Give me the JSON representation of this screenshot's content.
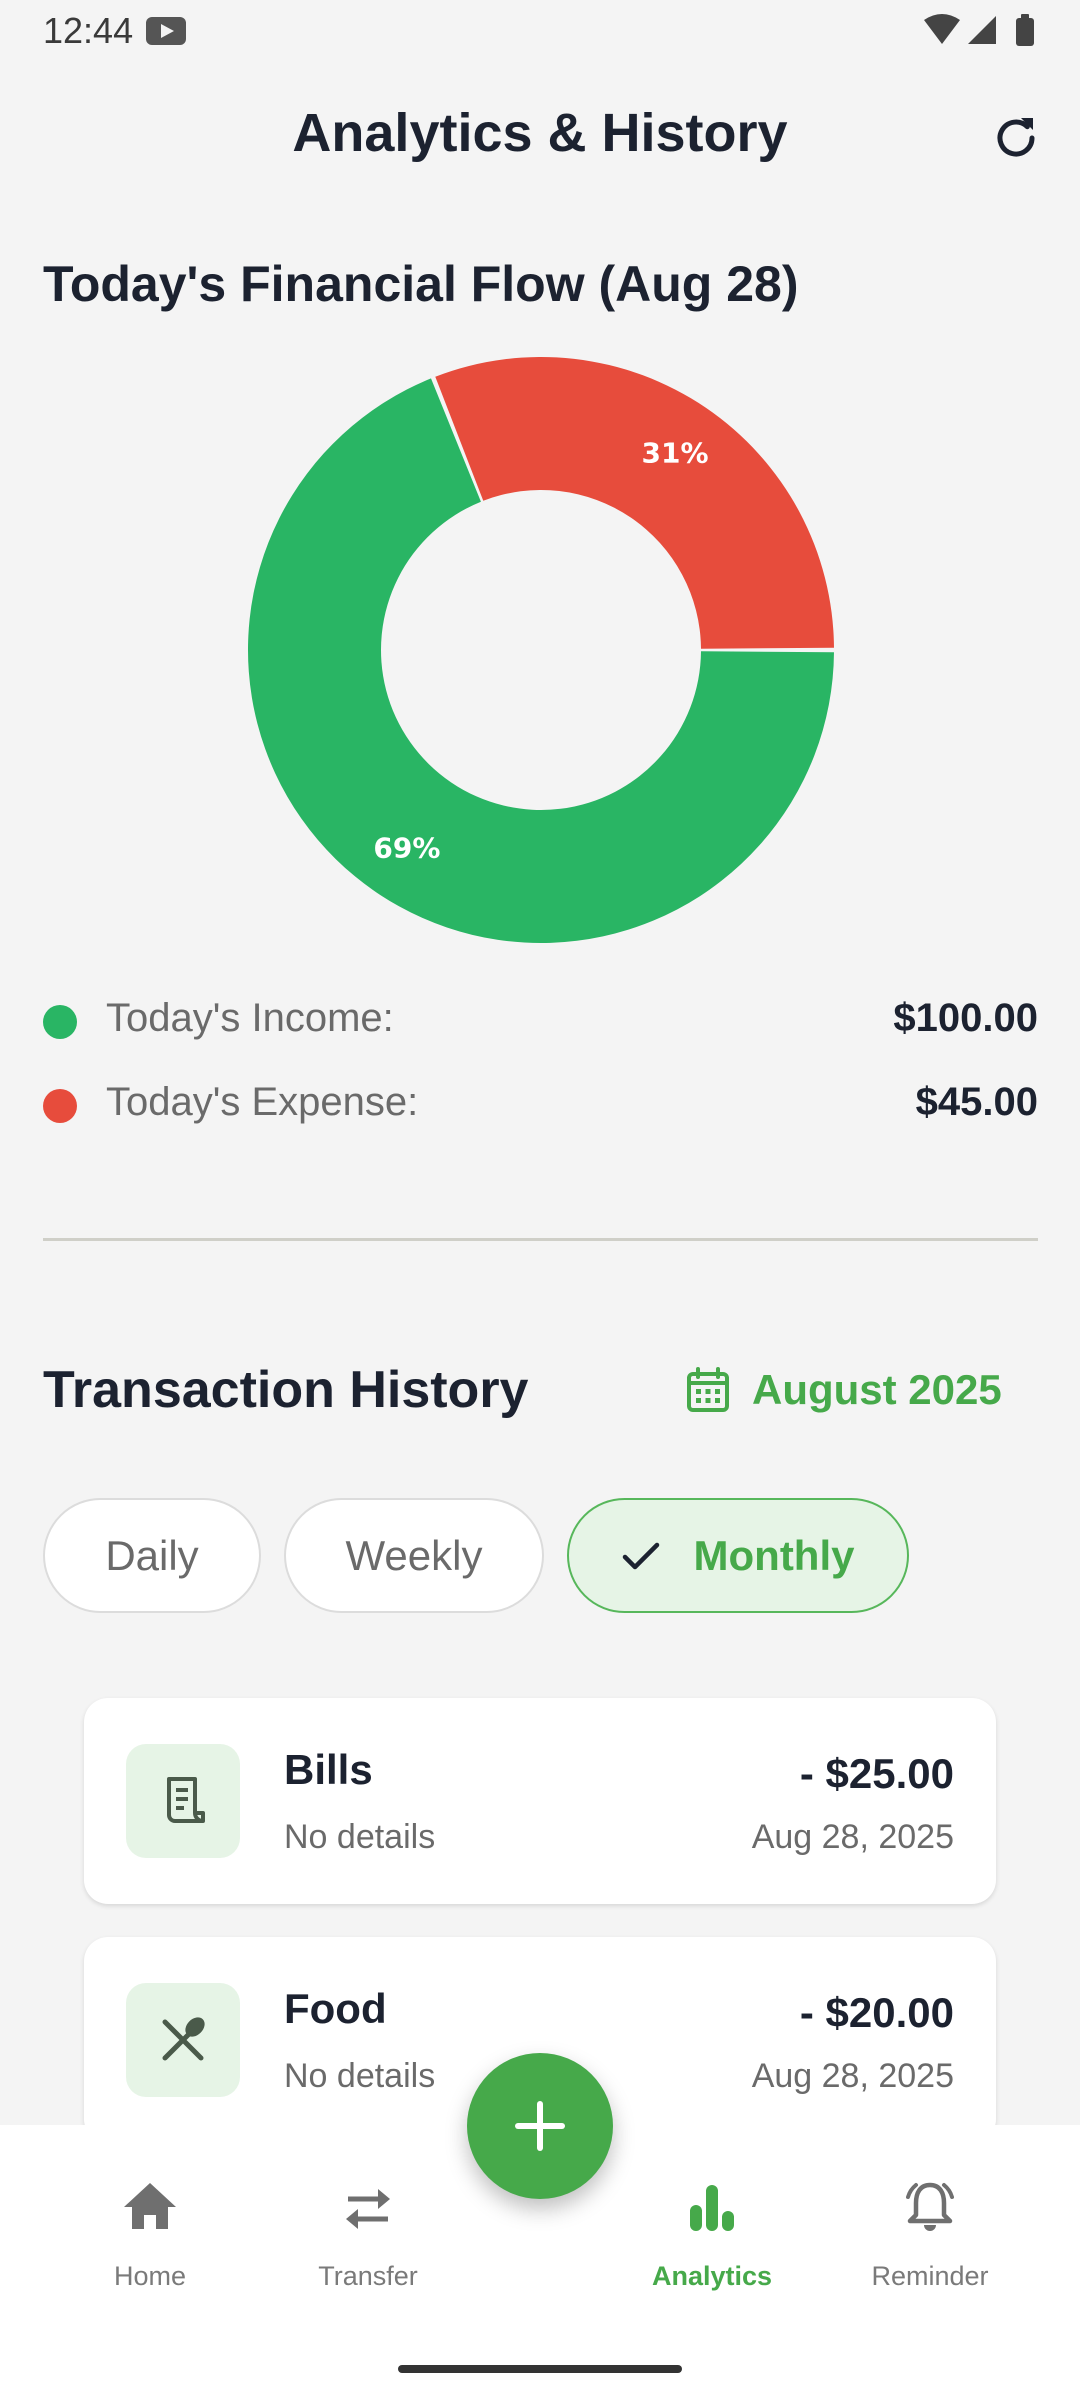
{
  "status_bar": {
    "time": "12:44"
  },
  "header": {
    "title": "Analytics & History"
  },
  "financial_flow": {
    "title": "Today's Financial Flow (Aug 28)",
    "chart_data": {
      "type": "pie",
      "categories": [
        "Today's Income",
        "Today's Expense"
      ],
      "values": [
        69,
        31
      ],
      "data_labels": [
        "69%",
        "31%"
      ],
      "colors": [
        "#29b564",
        "#e74c3c"
      ]
    },
    "legend": [
      {
        "label": "Today's Income:",
        "value": "$100.00",
        "color": "#29b564"
      },
      {
        "label": "Today's Expense:",
        "value": "$45.00",
        "color": "#e74c3c"
      }
    ]
  },
  "history": {
    "title": "Transaction History",
    "month": "August 2025",
    "filters": [
      {
        "label": "Daily",
        "selected": false
      },
      {
        "label": "Weekly",
        "selected": false
      },
      {
        "label": "Monthly",
        "selected": true
      }
    ],
    "transactions": [
      {
        "name": "Bills",
        "details": "No details",
        "amount": "- $25.00",
        "date": "Aug 28, 2025",
        "icon": "receipt-icon"
      },
      {
        "name": "Food",
        "details": "No details",
        "amount": "- $20.00",
        "date": "Aug 28, 2025",
        "icon": "utensils-icon"
      }
    ]
  },
  "nav": {
    "items": [
      {
        "label": "Home",
        "icon": "home-icon",
        "active": false
      },
      {
        "label": "Transfer",
        "icon": "transfer-icon",
        "active": false
      },
      {
        "label": "Analytics",
        "icon": "bar-chart-icon",
        "active": true
      },
      {
        "label": "Reminder",
        "icon": "bell-icon",
        "active": false
      }
    ],
    "fab_icon": "plus-icon"
  },
  "colors": {
    "accent": "#46a94a",
    "income": "#29b564",
    "expense": "#e74c3c",
    "text": "#1c2230"
  }
}
